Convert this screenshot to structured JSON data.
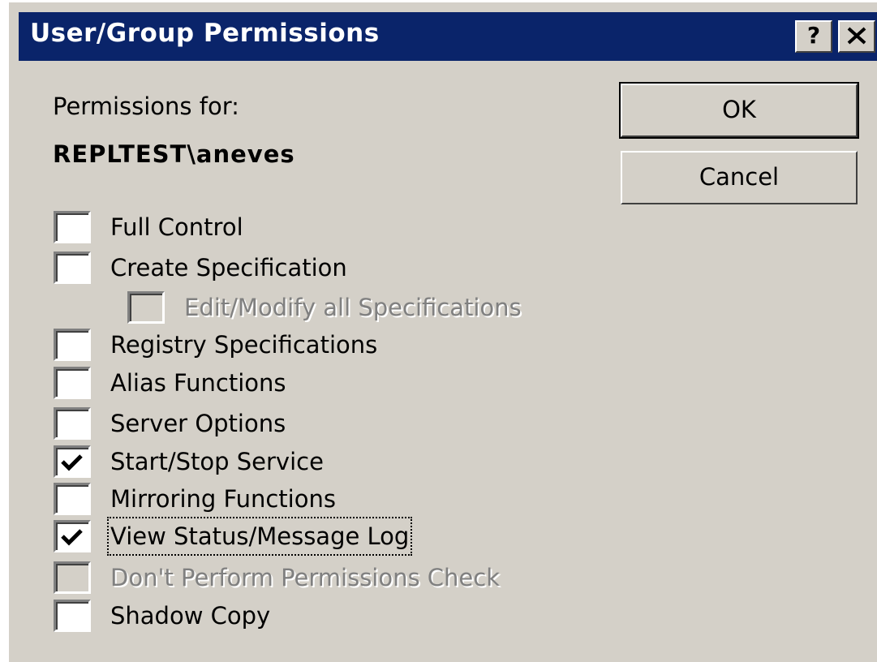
{
  "window": {
    "title": "User/Group Permissions",
    "help_label": "?",
    "close_icon": "close-icon",
    "colors": {
      "titlebar": "#0a246a",
      "face": "#d4d0c8"
    }
  },
  "header": {
    "permissions_for_label": "Permissions for:",
    "user": "REPLTEST\\aneves"
  },
  "buttons": {
    "ok_label": "OK",
    "cancel_label": "Cancel"
  },
  "permissions": [
    {
      "label": "Full Control",
      "checked": false,
      "enabled": true
    },
    {
      "label": "Create Specification",
      "checked": false,
      "enabled": true
    },
    {
      "label": "Edit/Modify all Specifications",
      "checked": false,
      "enabled": false
    },
    {
      "label": "Registry Specifications",
      "checked": false,
      "enabled": true
    },
    {
      "label": "Alias Functions",
      "checked": false,
      "enabled": true
    },
    {
      "label": "Server Options",
      "checked": false,
      "enabled": true
    },
    {
      "label": "Start/Stop Service",
      "checked": true,
      "enabled": true
    },
    {
      "label": "Mirroring Functions",
      "checked": false,
      "enabled": true
    },
    {
      "label": "View Status/Message Log",
      "checked": true,
      "enabled": true,
      "focused": true
    },
    {
      "label": "Don't Perform Permissions Check",
      "checked": false,
      "enabled": false
    },
    {
      "label": "Shadow Copy",
      "checked": false,
      "enabled": true
    }
  ]
}
